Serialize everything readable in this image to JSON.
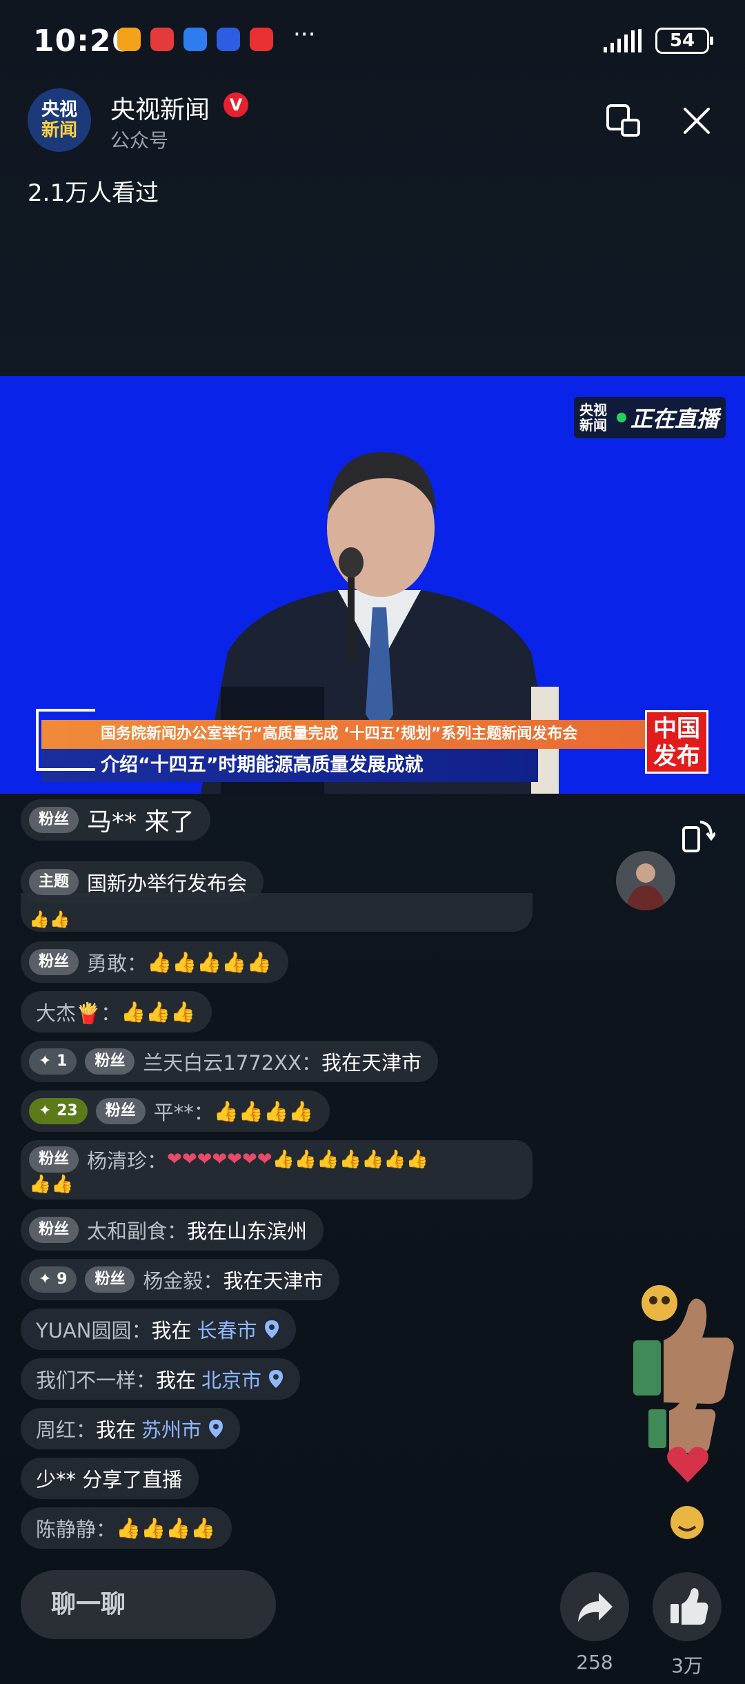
{
  "status_bar": {
    "time": "10:26",
    "battery": "54"
  },
  "header": {
    "avatar_line1": "央视",
    "avatar_line2": "新闻",
    "account_name": "央视新闻",
    "verified": "V",
    "account_type": "公众号",
    "viewers": "2.1万人看过"
  },
  "video": {
    "live_logo_l1": "央视",
    "live_logo_l2": "新闻",
    "live_text": "正在直播",
    "ticker_top": "国务院新闻办公室举行“高质量完成 ‘十四五’规划”系列主题新闻发布会",
    "ticker_main": "介绍“十四五”时期能源高质量发展成就",
    "corner_logo_l1": "中国",
    "corner_logo_l2": "发布"
  },
  "chat": [
    {
      "badge": "粉丝",
      "text": "马** 来了"
    },
    {
      "badge": "主题",
      "text": "国新办举行发布会"
    },
    {
      "text": "👍👍"
    },
    {
      "badge": "粉丝",
      "user": "勇敢：",
      "text": "👍👍👍👍👍"
    },
    {
      "user": "大杰🍟：",
      "text": "👍👍👍"
    },
    {
      "level": "✦ 1",
      "badge": "粉丝",
      "user": "兰天白云1772ⅩⅩ：",
      "text": "我在天津市"
    },
    {
      "level": "✦ 23",
      "badge": "粉丝",
      "user": "平**：",
      "text": "👍👍👍👍"
    },
    {
      "badge": "粉丝",
      "user": "杨清珍：",
      "text": "❤❤❤❤❤❤❤👍👍👍👍👍👍👍",
      "text2": "👍👍"
    },
    {
      "badge": "粉丝",
      "user": "太和副食：",
      "text": "我在山东滨州"
    },
    {
      "level": "✦ 9",
      "badge": "粉丝",
      "user": "杨金毅：",
      "text": "我在天津市"
    },
    {
      "user": "YUAN圆圆：",
      "text": "我在",
      "location": "长春市"
    },
    {
      "user": "我们不一样：",
      "text": "我在",
      "location": "北京市"
    },
    {
      "user": "周红：",
      "text": "我在",
      "location": "苏州市"
    },
    {
      "text": "少** 分享了直播"
    },
    {
      "user": "陈静静：",
      "text": "👍👍👍👍"
    }
  ],
  "bottom": {
    "chat_placeholder": "聊一聊",
    "share_count": "258",
    "like_count": "3万"
  }
}
